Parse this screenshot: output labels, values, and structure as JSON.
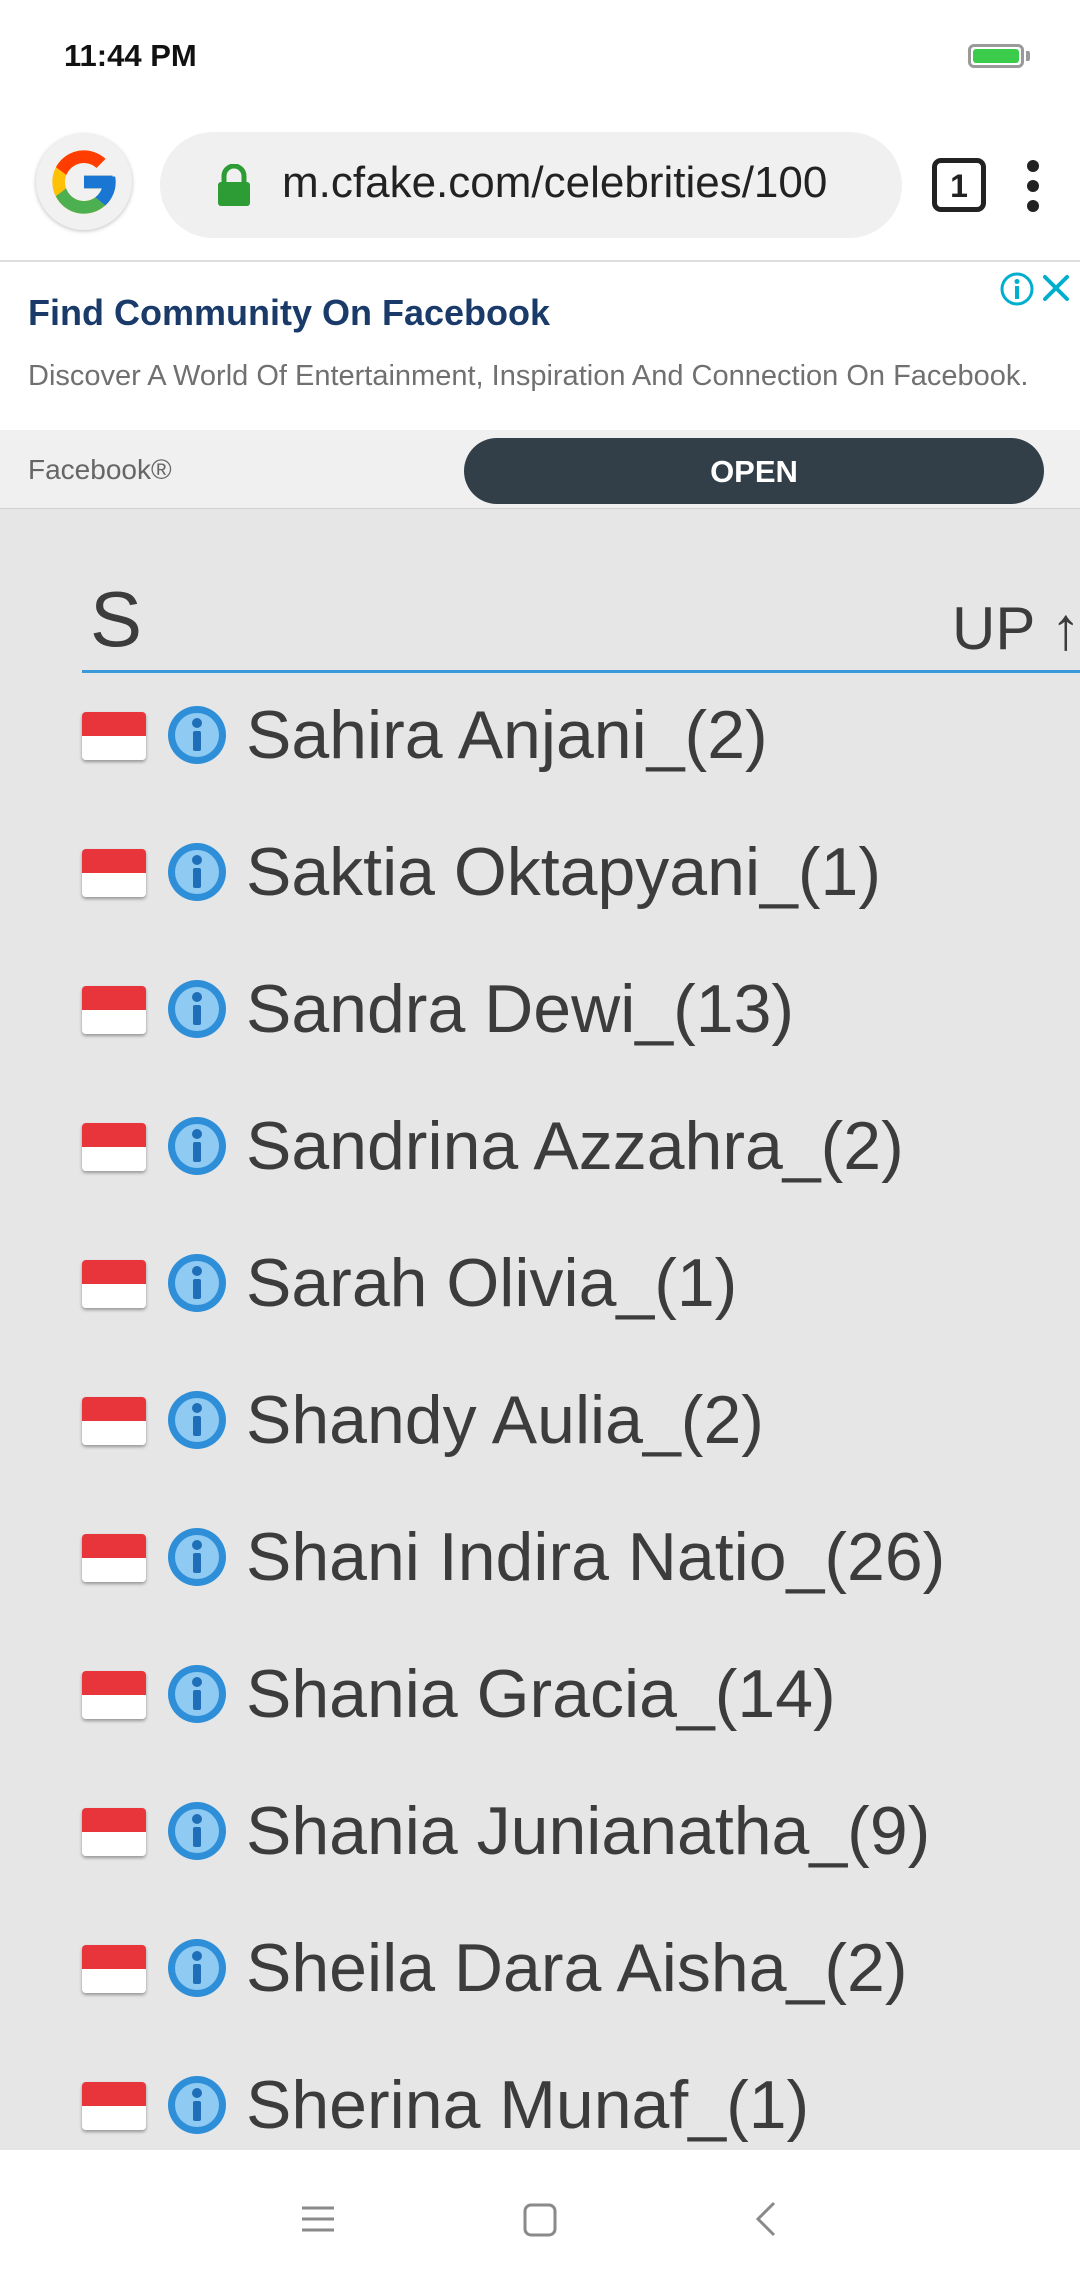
{
  "status_bar": {
    "time": "11:44 PM"
  },
  "browser": {
    "url": "m.cfake.com/celebrities/100",
    "tab_count": "1"
  },
  "ad": {
    "title": "Find Community On Facebook",
    "description": "Discover A World Of Entertainment, Inspiration And Connection On Facebook.",
    "brand": "Facebook®",
    "button_label": "OPEN"
  },
  "section": {
    "letter": "S",
    "up_label": "UP ↑"
  },
  "items": [
    {
      "name": "Sahira Anjani_(2)"
    },
    {
      "name": "Saktia Oktapyani_(1)"
    },
    {
      "name": "Sandra Dewi_(13)"
    },
    {
      "name": "Sandrina Azzahra_(2)"
    },
    {
      "name": "Sarah Olivia_(1)"
    },
    {
      "name": "Shandy Aulia_(2)"
    },
    {
      "name": "Shani Indira Natio_(26)"
    },
    {
      "name": "Shania Gracia_(14)"
    },
    {
      "name": "Shania Junianatha_(9)"
    },
    {
      "name": "Sheila Dara Aisha_(2)"
    },
    {
      "name": "Sherina Munaf_(1)"
    }
  ],
  "icons": {
    "flag": "indonesia-flag-icon",
    "info": "info-icon",
    "lock": "lock-icon",
    "menu": "more-vert-icon",
    "nav": [
      "menu-icon",
      "home-icon",
      "back-icon"
    ]
  },
  "colors": {
    "accent": "#3a9ad9",
    "ad_button": "#333f48",
    "lock": "#2e9c34",
    "battery": "#3ccc4c",
    "flag_red": "#e8353b"
  }
}
